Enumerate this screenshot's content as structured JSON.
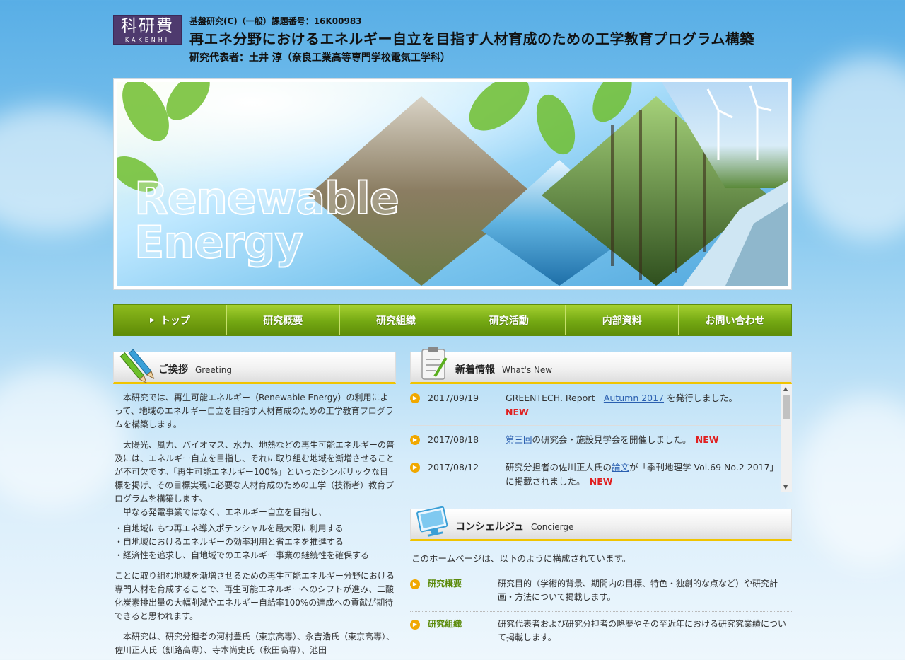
{
  "header": {
    "logo_kanji": "科研費",
    "logo_roman": "KAKENHI",
    "subtitle": "基盤研究(C)（一般）課題番号：16K00983",
    "title": "再エネ分野におけるエネルギー自立を目指す人材育成のための工学教育プログラム構築",
    "representative": "研究代表者：土井 淳（奈良工業高等専門学校電気工学科）"
  },
  "hero": {
    "line1": "Renewable",
    "line2": "Energy"
  },
  "nav": [
    {
      "label": "トップ",
      "active": true
    },
    {
      "label": "研究概要"
    },
    {
      "label": "研究組織"
    },
    {
      "label": "研究活動"
    },
    {
      "label": "内部資料"
    },
    {
      "label": "お問い合わせ"
    }
  ],
  "greeting": {
    "title": "ご挨拶",
    "title_en": "Greeting",
    "p1": "本研究では、再生可能エネルギー（Renewable Energy）の利用によって、地域のエネルギー自立を目指す人材育成のための工学教育プログラムを構築します。",
    "p2": "太陽光、風力、バイオマス、水力、地熱などの再生可能エネルギーの普及には、エネルギー自立を目指し、それに取り組む地域を漸増させることが不可欠です。「再生可能エネルギー100%」といったシンボリックな目標を掲げ、その目標実現に必要な人材育成のための工学（技術者）教育プログラムを構築します。",
    "p3": "単なる発電事業ではなく、エネルギー自立を目指し、",
    "bullets": [
      "・自地域にもつ再エネ導入ポテンシャルを最大限に利用する",
      "・自地域におけるエネルギーの効率利用と省エネを推進する",
      "・経済性を追求し、自地域でのエネルギー事業の継続性を確保する"
    ],
    "p4": "ことに取り組む地域を漸増させるための再生可能エネルギー分野における専門人材を育成することで、再生可能エネルギーへのシフトが進み、二酸化炭素排出量の大幅削減やエネルギー自給率100%の達成への貢献が期待できると思われます。",
    "p5": "本研究は、研究分担者の河村豊氏（東京高専）、永吉浩氏（東京高専）、佐川正人氏（釧路高専）、寺本尚史氏（秋田高専）、池田"
  },
  "news": {
    "title": "新着情報",
    "title_en": "What's New",
    "new_label": "NEW",
    "items": [
      {
        "date": "2017/09/19",
        "pre": "GREENTECH. Report　",
        "link": "Autumn 2017",
        "post": " を発行しました。"
      },
      {
        "date": "2017/08/18",
        "pre": "",
        "link": "第三回",
        "post": "の研究会・施設見学会を開催しました。　"
      },
      {
        "date": "2017/08/12",
        "pre": "研究分担者の佐川正人氏の",
        "link": "論文",
        "post": "が「季刊地理学 Vol.69 No.2 2017」に掲載されました。　"
      }
    ]
  },
  "concierge": {
    "title": "コンシェルジュ",
    "title_en": "Concierge",
    "intro": "このホームページは、以下のように構成されています。",
    "items": [
      {
        "label": "研究概要",
        "text": "研究目的（学術的背景、期間内の目標、特色・独創的な点など）や研究計画・方法について掲載します。"
      },
      {
        "label": "研究組織",
        "text": "研究代表者および研究分担者の略歴やその至近年における研究究業績について掲載します。"
      }
    ]
  },
  "colors": {
    "accent_green": "#74a813",
    "accent_yellow": "#f0c400",
    "logo_purple": "#4e3a6e",
    "new_red": "#e02020"
  }
}
